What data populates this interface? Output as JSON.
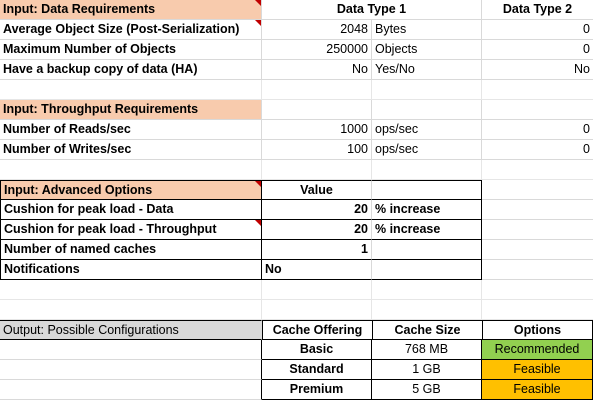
{
  "data_req": {
    "header": "Input: Data Requirements",
    "type1_header": "Data Type 1",
    "type2_header": "Data Type 2",
    "rows": [
      {
        "label": "Average Object Size (Post-Serialization)",
        "v1": "2048",
        "unit": "Bytes",
        "v2": "0"
      },
      {
        "label": "Maximum Number of Objects",
        "v1": "250000",
        "unit": "Objects",
        "v2": "0"
      },
      {
        "label": "Have a backup copy of data (HA)",
        "v1": "No",
        "unit": "Yes/No",
        "v2": "No"
      }
    ]
  },
  "throughput_req": {
    "header": "Input: Throughput Requirements",
    "rows": [
      {
        "label": "Number of Reads/sec",
        "v1": "1000",
        "unit": "ops/sec",
        "v2": "0"
      },
      {
        "label": "Number of Writes/sec",
        "v1": "100",
        "unit": "ops/sec",
        "v2": "0"
      }
    ]
  },
  "advanced": {
    "header": "Input: Advanced Options",
    "value_header": "Value",
    "rows": [
      {
        "label": "Cushion for peak load - Data",
        "value": "20",
        "unit": "% increase"
      },
      {
        "label": "Cushion for peak load - Throughput",
        "value": "20",
        "unit": "% increase"
      },
      {
        "label": "Number of named caches",
        "value": "1",
        "unit": ""
      },
      {
        "label": "Notifications",
        "value": "No",
        "unit": ""
      }
    ]
  },
  "output": {
    "header": "Output: Possible Configurations",
    "col_offering": "Cache Offering",
    "col_size": "Cache Size",
    "col_options": "Options",
    "rows": [
      {
        "offering": "Basic",
        "size": "768 MB",
        "option": "Recommended",
        "color": "#92d050"
      },
      {
        "offering": "Standard",
        "size": "1 GB",
        "option": "Feasible",
        "color": "#ffc000"
      },
      {
        "offering": "Premium",
        "size": "5 GB",
        "option": "Feasible",
        "color": "#ffc000"
      }
    ]
  }
}
